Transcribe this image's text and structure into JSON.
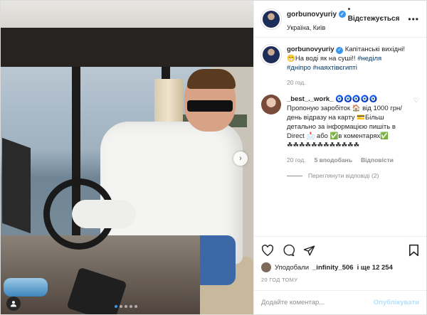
{
  "post": {
    "username": "gorbunovyuriy",
    "follow_label": "• Відстежується",
    "location": "Україна, Київ",
    "more_label": "•••",
    "caption": {
      "username": "gorbunovyuriy",
      "text1": "Капітанські вихідні!",
      "text2": "😁На воді як на суші!!",
      "tags": [
        "#неділя",
        "#дніпро",
        "#наяхтівєгипті"
      ],
      "time": "20 год."
    },
    "comment": {
      "username": "_best_._work_",
      "badges": "🧿🧿🧿🧿🧿",
      "text": "Пропоную заробіток 🏠 від 1000 грн/день відразу на карту 💳Більш детально за інформацією пишіть в Direct 📩 або ✅в коментарях✅",
      "clovers": "☘☘☘☘☘☘☘☘☘☘☘☘",
      "time": "20 год.",
      "likes": "5 вподобань",
      "reply": "Відповісти",
      "hidden_replies": "Переглянути відповіді (2)"
    },
    "likes": {
      "prefix": "Уподобали",
      "user": "_infinity_506",
      "suffix": "і ще 12 254"
    },
    "posted": "20 ГОД ТОМУ",
    "add_comment_placeholder": "Додайте коментар...",
    "publish_label": "Опублікувати"
  },
  "photo": {
    "next_icon": "›",
    "user_icon": "person-icon"
  },
  "colors": {
    "accent": "#3897f0",
    "link": "#00376b",
    "muted": "#8e8e8e",
    "publish_disabled": "#b2dffc"
  }
}
